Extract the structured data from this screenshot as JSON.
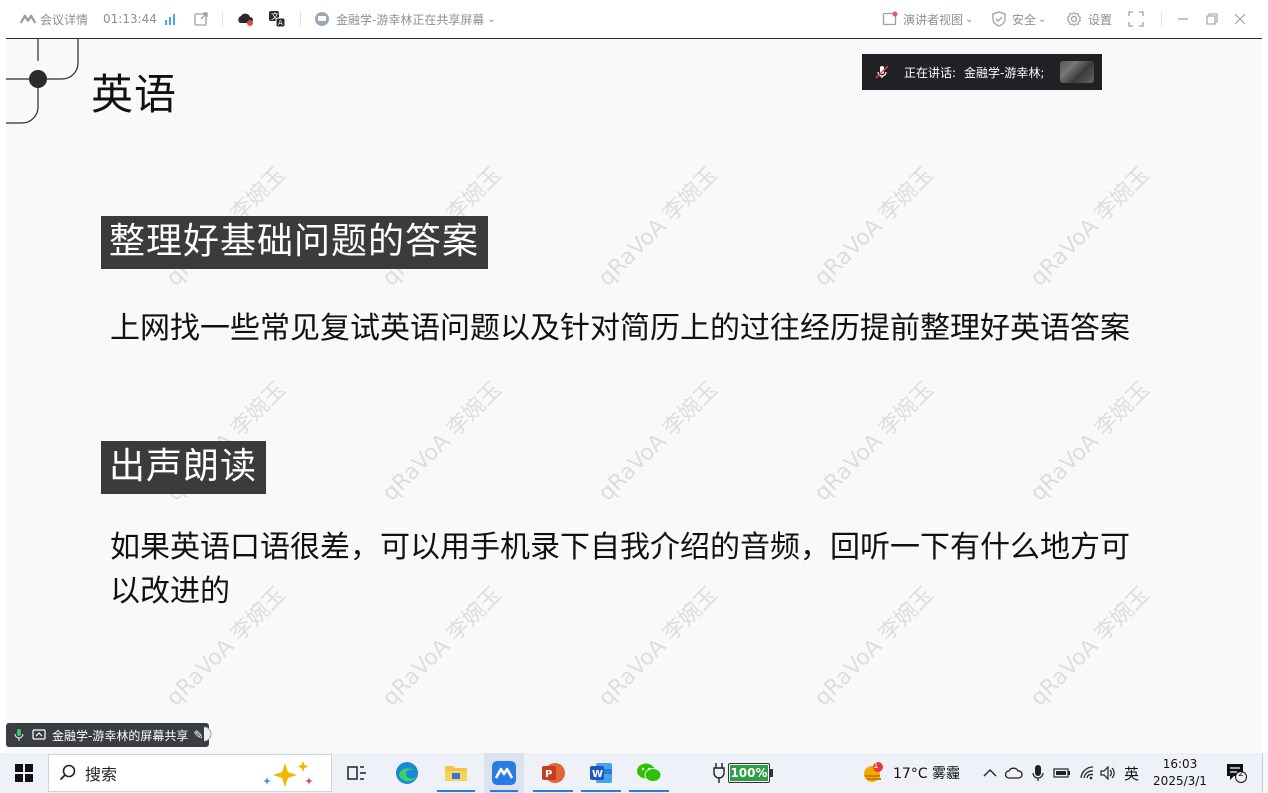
{
  "topbar": {
    "meeting_info": "会议详情",
    "timer": "01:13:44",
    "share_status": "金融学-游幸林正在共享屏幕",
    "presenter_view": "演讲者视图",
    "security": "安全",
    "settings": "设置"
  },
  "speaking": {
    "label": "正在讲话:",
    "name": "金融学-游幸林;"
  },
  "slide": {
    "title": "英语",
    "sections": [
      {
        "heading": "整理好基础问题的答案",
        "body": "上网找一些常见复试英语问题以及针对简历上的过往经历提前整理好英语答案"
      },
      {
        "heading": "出声朗读",
        "body_line1": "如果英语口语很差，可以用手机录下自我介绍的音频，回听一下有什么地方可",
        "body_line2": "以改进的"
      }
    ],
    "watermark": "qRaVoA 李婉玉"
  },
  "share_tag": "金融学-游幸林的屏幕共享",
  "taskbar": {
    "search_label": "搜索",
    "battery": "100%",
    "weather": "17°C  雾霾",
    "ime": "英",
    "time": "16:03",
    "date": "2025/3/1",
    "notifications": "2",
    "weather_badge": "1"
  },
  "colors": {
    "heading_bg": "#3b3b3b",
    "speaking_bg": "#1f2125",
    "accent": "#2a7ae2"
  }
}
